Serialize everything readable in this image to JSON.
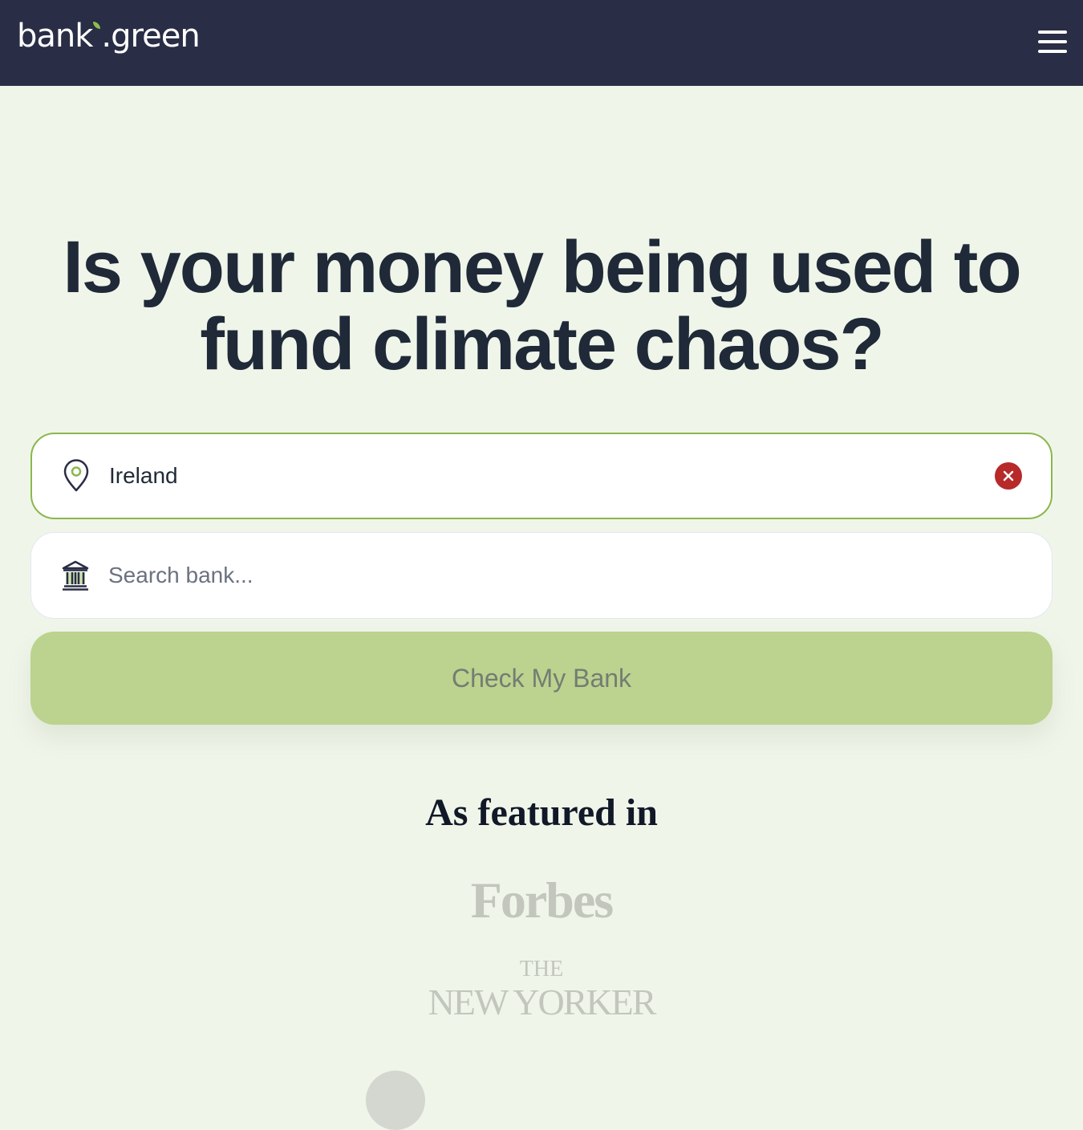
{
  "header": {
    "logo_left": "bank",
    "logo_right": "green",
    "logo_dot": "."
  },
  "hero": {
    "headline_line1": "Is your money being used to",
    "headline_line2": "fund climate chaos?"
  },
  "location_field": {
    "value": "Ireland",
    "icon": "location-pin-icon",
    "clear_icon": "clear-icon"
  },
  "bank_field": {
    "placeholder": "Search bank...",
    "icon": "bank-building-icon"
  },
  "check_button": {
    "label": "Check My Bank"
  },
  "featured": {
    "heading": "As featured in",
    "logos": {
      "forbes": "Forbes",
      "newyorker_the": "THE",
      "newyorker_name": "NEW YORKER"
    }
  },
  "colors": {
    "nav_bg": "#292d45",
    "page_bg": "#f0f5ea",
    "accent_green": "#8bb74b",
    "button_green": "#bbd38e",
    "clear_red": "#b8292a"
  }
}
